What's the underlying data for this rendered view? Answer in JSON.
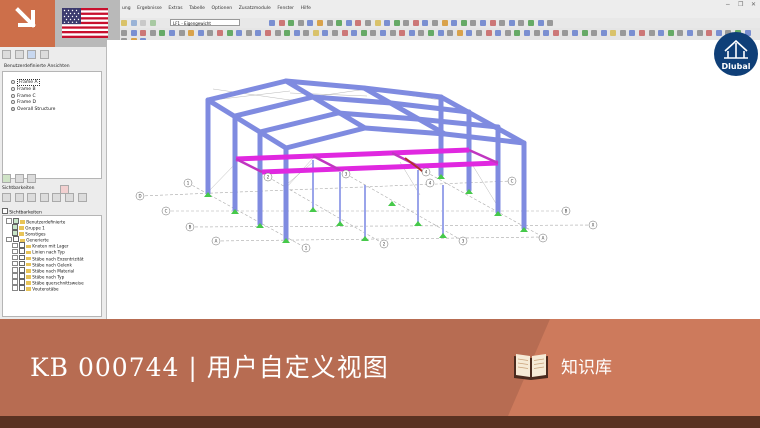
{
  "menubar": {
    "items": [
      "ung",
      "Ergebnisse",
      "Extras",
      "Tabelle",
      "Optionen",
      "Zusatzmodule",
      "Fenster",
      "Hilfe"
    ],
    "window_controls": [
      "−",
      "❐",
      "✕"
    ]
  },
  "toolbar": {
    "load_case": "LF1 - Eigengewicht"
  },
  "views_panel": {
    "title": "Benutzerdefinierte Ansichten",
    "items": [
      {
        "label": "Frame A",
        "selected": false
      },
      {
        "label": "Frame B",
        "selected": false
      },
      {
        "label": "Frame C",
        "selected": false
      },
      {
        "label": "Frame D",
        "selected": false
      },
      {
        "label": "Overall Structure",
        "selected": true
      }
    ]
  },
  "visibility_panel": {
    "header": "Sichtbarkeiten",
    "checkbox_label": "Sichtbarkeiten",
    "tree": [
      {
        "label": "Benutzerdefinierte",
        "level": 0,
        "checked": true
      },
      {
        "label": "Gruppe 1",
        "level": 1,
        "checked": true
      },
      {
        "label": "Sonstiges",
        "level": 1,
        "checked": true
      },
      {
        "label": "Generierte",
        "level": 0,
        "checked": false
      },
      {
        "label": "Knoten mit Lager",
        "level": 1,
        "checked": false
      },
      {
        "label": "Linien nach Typ",
        "level": 1,
        "checked": false
      },
      {
        "label": "Stäbe nach Exzentrizität",
        "level": 1,
        "checked": false
      },
      {
        "label": "Stäbe nach Gelenk",
        "level": 1,
        "checked": false
      },
      {
        "label": "Stäbe nach Material",
        "level": 1,
        "checked": false
      },
      {
        "label": "Stäbe nach Typ",
        "level": 1,
        "checked": false
      },
      {
        "label": "Stäbe querschnittsweise",
        "level": 1,
        "checked": false
      },
      {
        "label": "Voutenstäbe",
        "level": 1,
        "checked": false
      }
    ]
  },
  "model_labels": {
    "axis_letters": [
      "D",
      "C",
      "B",
      "A",
      "C",
      "B",
      "A",
      "X"
    ],
    "axis_numbers": [
      "1",
      "2",
      "3",
      "4",
      "1",
      "2",
      "3",
      "4"
    ]
  },
  "logo": {
    "text": "Dlubal"
  },
  "banner": {
    "title": "KB 000744 | 用户自定义视图",
    "category": "知识库"
  },
  "colors": {
    "banner": "#b76c52",
    "banner_accent": "#cd7a5c",
    "footer": "#5a3222",
    "members": "#7f8be0",
    "highlight": "#e028e0",
    "support": "#46c94a",
    "logo": "#0f3f78"
  }
}
